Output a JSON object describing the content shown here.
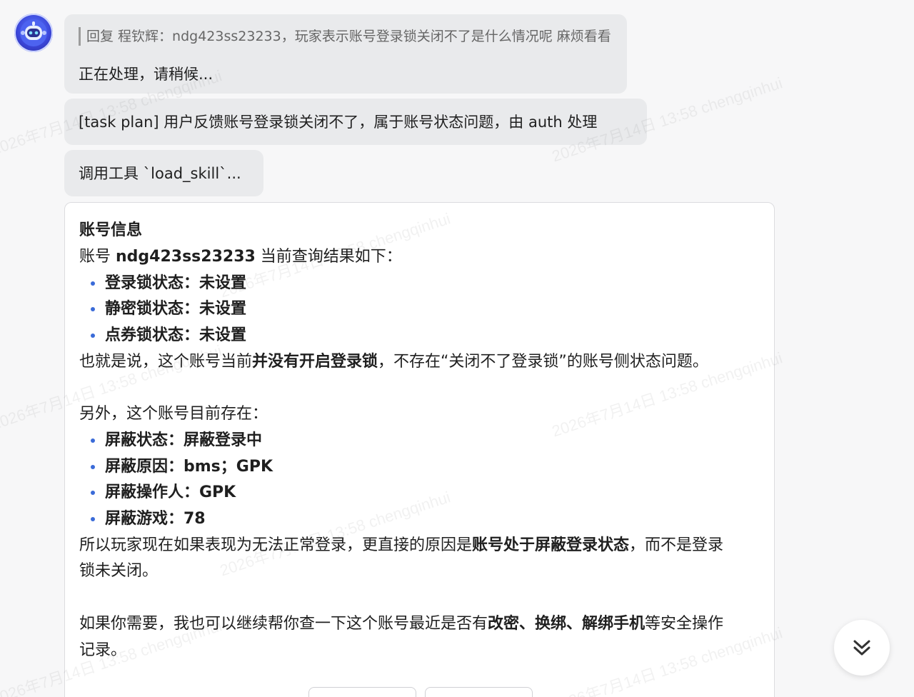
{
  "messages": {
    "reply_quote": "回复 程钦辉：ndg423ss23233，玩家表示账号登录锁关闭不了是什么情况呢 麻烦看看",
    "processing": "正在处理，请稍候...",
    "task_plan": "[task plan] 用户反馈账号登录锁关闭不了，属于账号状态问题，由 auth 处理",
    "tool_call": "调用工具 `load_skill`..."
  },
  "card": {
    "title": "账号信息",
    "intro_prefix": "账号 ",
    "account_id": "ndg423ss23233",
    "intro_suffix": " 当前查询结果如下：",
    "lock_items": [
      "登录锁状态：未设置",
      "静密锁状态：未设置",
      "点券锁状态：未设置"
    ],
    "summary_prefix": "也就是说，这个账号当前",
    "summary_bold": "并没有开启登录锁",
    "summary_suffix": "，不存在“关闭不了登录锁”的账号侧状态问题。",
    "also_line": "另外，这个账号目前存在：",
    "block_items": [
      "屏蔽状态：屏蔽登录中",
      "屏蔽原因：bms；GPK",
      "屏蔽操作人：GPK",
      "屏蔽游戏：78"
    ],
    "reason_prefix": "所以玩家现在如果表现为无法正常登录，更直接的原因是",
    "reason_bold": "账号处于屏蔽登录状态",
    "reason_suffix": "，而不是登录",
    "reason_line2": "锁未关闭。",
    "offer_prefix": "如果你需要，我也可以继续帮你查一下这个账号最近是否有",
    "offer_bold": "改密、换绑、解绑手机",
    "offer_suffix": "等安全操作",
    "offer_line2": "记录。"
  },
  "watermark_text": "2026年7月14日 13:58 chengqinhui",
  "icons": {
    "avatar": "robot-avatar-icon",
    "scroll": "double-chevron-down-icon"
  },
  "colors": {
    "bubble_bg": "#e9eaec",
    "bullet": "#3a6bd8",
    "avatar": "#3b46d9"
  }
}
